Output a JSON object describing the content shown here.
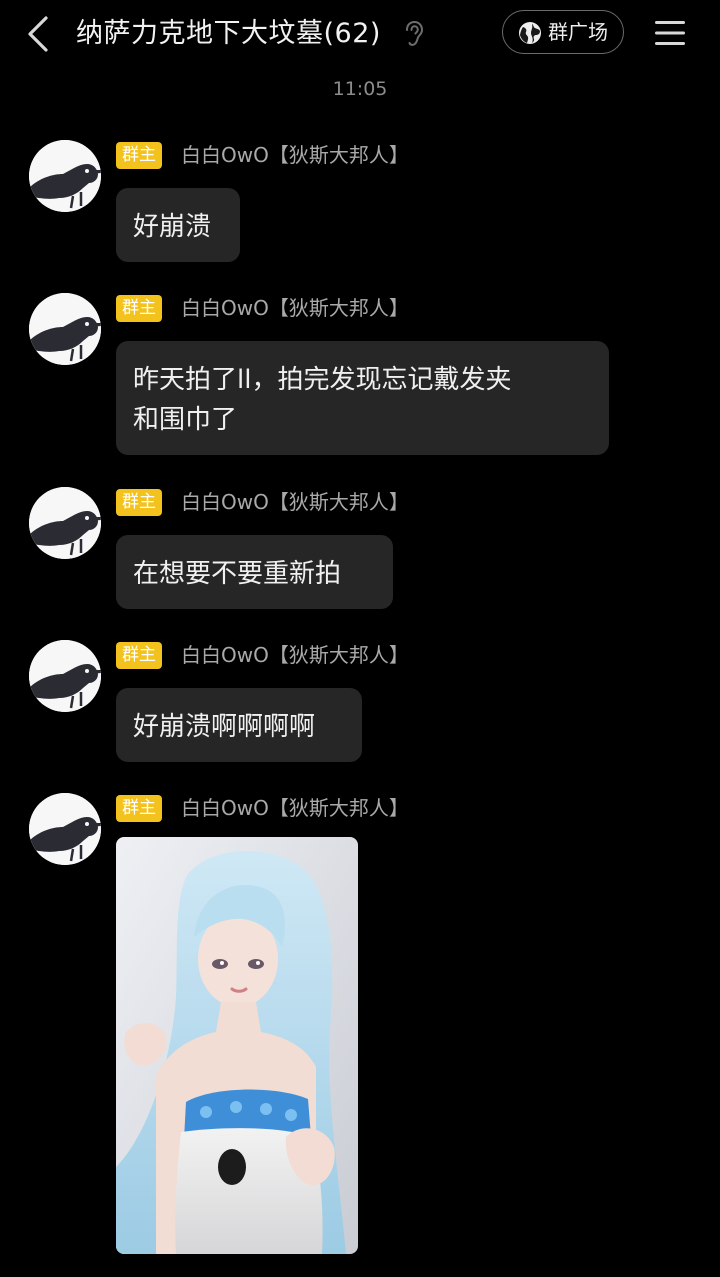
{
  "header": {
    "title": "纳萨力克地下大坟墓(62)",
    "square_label": "群广场",
    "back_icon": "chevron-left-icon",
    "ear_icon": "ear-icon",
    "globe_icon": "globe-icon",
    "menu_icon": "hamburger-menu-icon"
  },
  "timestamp": "11:05",
  "messages": [
    {
      "badge": "群主",
      "sender": "白白OwO【狄斯大邦人】",
      "text": "好崩溃"
    },
    {
      "badge": "群主",
      "sender": "白白OwO【狄斯大邦人】",
      "text": "昨天拍了ll，拍完发现忘记戴发夹\n和围巾了"
    },
    {
      "badge": "群主",
      "sender": "白白OwO【狄斯大邦人】",
      "text": "在想要不要重新拍"
    },
    {
      "badge": "群主",
      "sender": "白白OwO【狄斯大邦人】",
      "text": "好崩溃啊啊啊啊"
    },
    {
      "badge": "群主",
      "sender": "白白OwO【狄斯大邦人】",
      "image": "cosplay-photo"
    }
  ],
  "colors": {
    "background": "#000000",
    "bubble": "#262626",
    "badge": "#f3c21d",
    "sender": "#a9a9a9"
  }
}
